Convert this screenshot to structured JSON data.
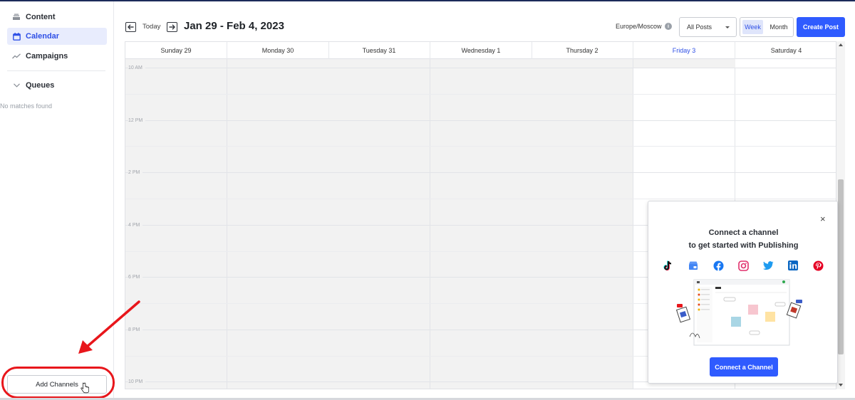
{
  "sidebar": {
    "items": [
      {
        "label": "Content",
        "icon": "content-icon"
      },
      {
        "label": "Calendar",
        "icon": "calendar-icon",
        "active": true
      },
      {
        "label": "Campaigns",
        "icon": "campaigns-icon"
      }
    ],
    "queues_label": "Queues",
    "no_matches": "No matches found",
    "add_channels_label": "Add Channels"
  },
  "header": {
    "today_label": "Today",
    "date_range": "Jan 29 - Feb 4, 2023",
    "timezone": "Europe/Moscow",
    "posts_filter": "All Posts",
    "week_label": "Week",
    "month_label": "Month",
    "create_post_label": "Create Post"
  },
  "calendar": {
    "days": [
      {
        "label": "Sunday  29"
      },
      {
        "label": "Monday  30"
      },
      {
        "label": "Tuesday  31"
      },
      {
        "label": "Wednesday  1"
      },
      {
        "label": "Thursday  2"
      },
      {
        "label": "Friday  3",
        "today": true
      },
      {
        "label": "Saturday  4"
      }
    ],
    "time_labels": [
      "10 AM",
      "12 PM",
      "2 PM",
      "4 PM",
      "6 PM",
      "8 PM",
      "10 PM"
    ]
  },
  "popup": {
    "close_label": "×",
    "title_line1": "Connect a channel",
    "title_line2": "to get started with Publishing",
    "networks": [
      "tiktok-icon",
      "google-business-icon",
      "facebook-icon",
      "instagram-icon",
      "twitter-icon",
      "linkedin-icon",
      "pinterest-icon"
    ],
    "connect_label": "Connect a Channel"
  },
  "colors": {
    "accent": "#2f5bff",
    "active_nav_bg": "#e8ecfd",
    "annotation_red": "#e8161b"
  }
}
